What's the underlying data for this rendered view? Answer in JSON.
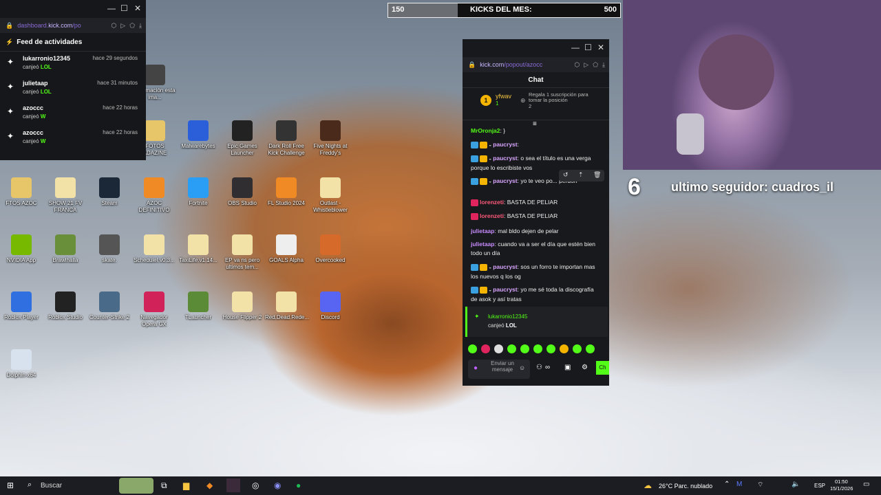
{
  "activity": {
    "url_prefix": "dashboard.",
    "url_main": "kick.com",
    "url_suffix": "/po",
    "heading": "Feed de actividades",
    "items": [
      {
        "user": "lukarronio12345",
        "action": "canjeó",
        "reward": "LOL",
        "time": "hace 29 segundos"
      },
      {
        "user": "julietaap",
        "action": "canjeó",
        "reward": "LOL",
        "time": "hace 31 minutos"
      },
      {
        "user": "azoccc",
        "action": "canjeó",
        "reward": "W",
        "time": "hace 22 horas"
      },
      {
        "user": "azoccc",
        "action": "canjeó",
        "reward": "W",
        "time": "hace 22 horas"
      }
    ]
  },
  "kicks": {
    "current": "150",
    "label": "KICKS DEL MES:",
    "goal": "500",
    "progress": 0.3
  },
  "overlay": {
    "count": "6",
    "follower": "ultimo seguidor: cuadros_il"
  },
  "chat": {
    "url_main": "kick.com",
    "url_rest": "/popout/azocc",
    "title": "Chat",
    "pinned_user": "yfwav",
    "pinned_count": "1",
    "pinned_rank": "1",
    "pinned_text": "Regala 1 suscripción para tomar la posición",
    "pinned_pos": "2",
    "messages": [
      {
        "user": "MrOronja2",
        "text": "}",
        "color": "#53fc18"
      },
      {
        "user": "paucryst",
        "text": "",
        "color": "#d9a5ff"
      },
      {
        "user": "paucryst",
        "text": "o sea el título es una verga porque lo escribiste vos",
        "color": "#d9a5ff"
      },
      {
        "user": "paucryst",
        "text": "yo te veo po... perdón",
        "color": "#d9a5ff"
      },
      {
        "user": "lorenzeti",
        "text": "BASTA DE PELIAR",
        "color": "#ff5a7a"
      },
      {
        "user": "lorenzeti",
        "text": "BASTA DE PELIAR",
        "color": "#ff5a7a"
      },
      {
        "user": "julietaap",
        "text": "mal bldo dejen de pelar",
        "color": "#c88cff"
      },
      {
        "user": "julietaap",
        "text": "cuando va a ser el día que estén bien todo un día",
        "color": "#c88cff"
      },
      {
        "user": "paucryst",
        "text": "sos un forro te importan mas los nuevos q los og",
        "color": "#d9a5ff"
      },
      {
        "user": "paucryst",
        "text": "yo me sé toda la discografía de asok y así tratas",
        "color": "#d9a5ff"
      }
    ],
    "redeem_user": "lukarronio12345",
    "redeem_action": "canjeó",
    "redeem_reward": "LOL",
    "input_placeholder": "Enviar un mensaje",
    "send_label": "Ch"
  },
  "desktop_icons": [
    {
      "label": "Información esta ima...",
      "color": "#444"
    },
    {
      "label": "FOTOS ADAZINE",
      "color": "#e7c66a"
    },
    {
      "label": "Malwarebytes",
      "color": "#2b5fd9"
    },
    {
      "label": "Epic Games Launcher",
      "color": "#222"
    },
    {
      "label": "Dark Roll Free Kick Challenge",
      "color": "#333"
    },
    {
      "label": "Five Nights at Freddy's",
      "color": "#4a2a1a"
    },
    {
      "label": "FTOS AZOC",
      "color": "#e7c66a"
    },
    {
      "label": "SHOW 21 FV FRANCA",
      "color": "#f3e2a8"
    },
    {
      "label": "Steam",
      "color": "#1b2838"
    },
    {
      "label": "AZOC DEFINITIVO",
      "color": "#f08a24"
    },
    {
      "label": "Fortnite",
      "color": "#2a9df4"
    },
    {
      "label": "OBS Studio",
      "color": "#302e31"
    },
    {
      "label": "FL Studio 2024",
      "color": "#f08a24"
    },
    {
      "label": "Outlast - Whistleblower",
      "color": "#f3e2a8"
    },
    {
      "label": "NVIDIA App",
      "color": "#76b900"
    },
    {
      "label": "Brawlhalla",
      "color": "#6a8f3a"
    },
    {
      "label": "skate.",
      "color": "#555"
    },
    {
      "label": "ScheduleI.v0.3...",
      "color": "#f3e2a8"
    },
    {
      "label": "TaxiLife.v1.14...",
      "color": "#f3e2a8"
    },
    {
      "label": "EP va ns pero ultimos tem...",
      "color": "#f3e2a8"
    },
    {
      "label": "GOALS Alpha",
      "color": "#eee"
    },
    {
      "label": "Overcooked",
      "color": "#d66a2a"
    },
    {
      "label": "Roblox Player",
      "color": "#2f6fe0"
    },
    {
      "label": "Roblox Studio",
      "color": "#222"
    },
    {
      "label": "Counter-Strike 2",
      "color": "#4a6a8a"
    },
    {
      "label": "Navegador Opera GX",
      "color": "#d1225a"
    },
    {
      "label": "TLauncher",
      "color": "#5b8b36"
    },
    {
      "label": "House Flipper 2",
      "color": "#f3e2a8"
    },
    {
      "label": "Red.Dead.Rede...",
      "color": "#f3e2a8"
    },
    {
      "label": "Discord",
      "color": "#5865f2"
    },
    {
      "label": "Dolphin-x64",
      "color": "#d8e2ee"
    }
  ],
  "taskbar": {
    "search": "Buscar",
    "weather": "26°C Parc. nublado",
    "lang": "ESP",
    "time": "01:50",
    "date": "15/1/2026"
  }
}
